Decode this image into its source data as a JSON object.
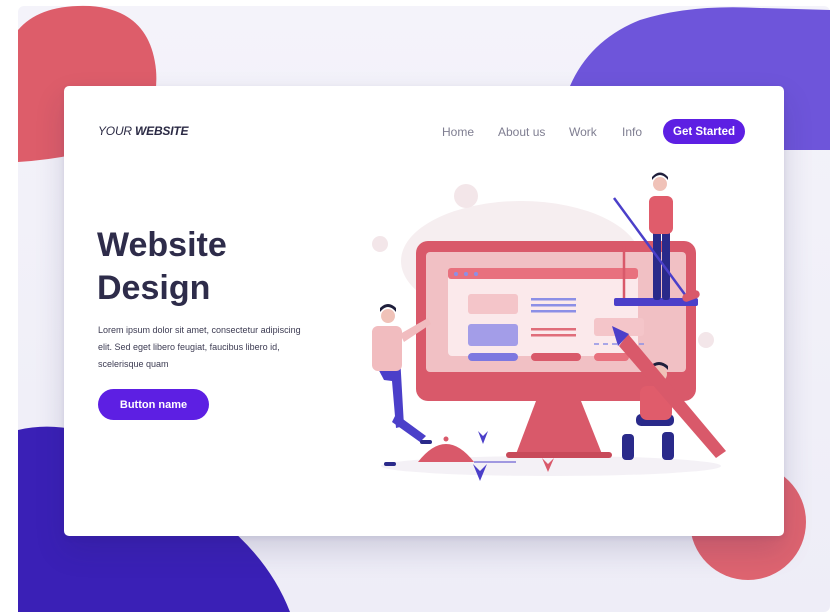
{
  "header": {
    "brand_prefix": "YOUR ",
    "brand_bold": "WEBSITE",
    "nav": [
      "Home",
      "About us",
      "Work",
      "Info"
    ],
    "cta_label": "Get Started"
  },
  "hero": {
    "title_line1": "Website",
    "title_line2": "Design",
    "description": "Lorem ipsum dolor sit amet, consectetur adipiscing elit. Sed eget libero feugiat, faucibus libero id, scelerisque quam",
    "button_label": "Button name"
  },
  "colors": {
    "accent": "#5d1fe3",
    "coral": "#d94f5e",
    "violet": "#6a4de0",
    "indigo": "#3b22b5"
  },
  "illustration": {
    "name": "website-design-team-illustration"
  }
}
